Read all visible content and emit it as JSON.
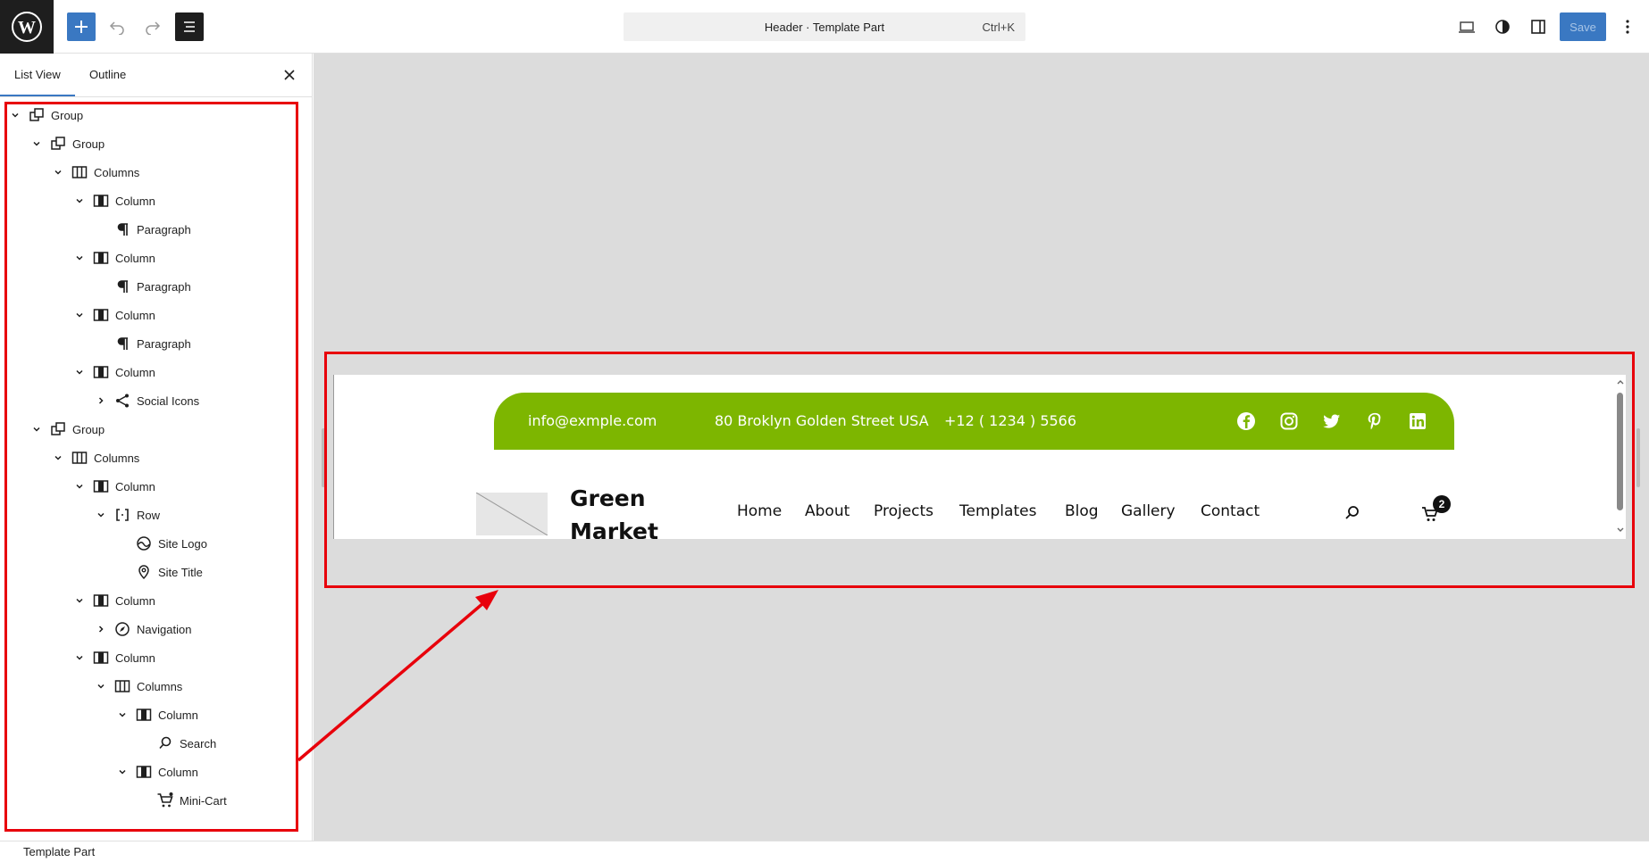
{
  "toolbar": {
    "command_title": "Header · Template Part",
    "command_shortcut": "Ctrl+K",
    "save_label": "Save"
  },
  "panel": {
    "tabs": [
      {
        "label": "List View"
      },
      {
        "label": "Outline"
      }
    ],
    "tree": [
      {
        "label": "Group"
      },
      {
        "label": "Group"
      },
      {
        "label": "Columns"
      },
      {
        "label": "Column"
      },
      {
        "label": "Paragraph"
      },
      {
        "label": "Column"
      },
      {
        "label": "Paragraph"
      },
      {
        "label": "Column"
      },
      {
        "label": "Paragraph"
      },
      {
        "label": "Column"
      },
      {
        "label": "Social Icons"
      },
      {
        "label": "Group"
      },
      {
        "label": "Columns"
      },
      {
        "label": "Column"
      },
      {
        "label": "Row"
      },
      {
        "label": "Site Logo"
      },
      {
        "label": "Site Title"
      },
      {
        "label": "Column"
      },
      {
        "label": "Navigation"
      },
      {
        "label": "Column"
      },
      {
        "label": "Columns"
      },
      {
        "label": "Column"
      },
      {
        "label": "Search"
      },
      {
        "label": "Column"
      },
      {
        "label": "Mini-Cart"
      }
    ]
  },
  "preview": {
    "email": "info@exmple.com",
    "address": "80 Broklyn Golden Street USA",
    "phone": "+12 ( 1234 ) 5566",
    "site_title": "Green Market",
    "nav": [
      "Home",
      "About",
      "Projects",
      "Templates",
      "Blog",
      "Gallery",
      "Contact"
    ],
    "cart_count": "2",
    "accent_color": "#7db600"
  },
  "footer": {
    "breadcrumb": "Template Part"
  },
  "icons": {
    "social": [
      "facebook-icon",
      "instagram-icon",
      "twitter-icon",
      "pinterest-icon",
      "linkedin-icon"
    ]
  }
}
